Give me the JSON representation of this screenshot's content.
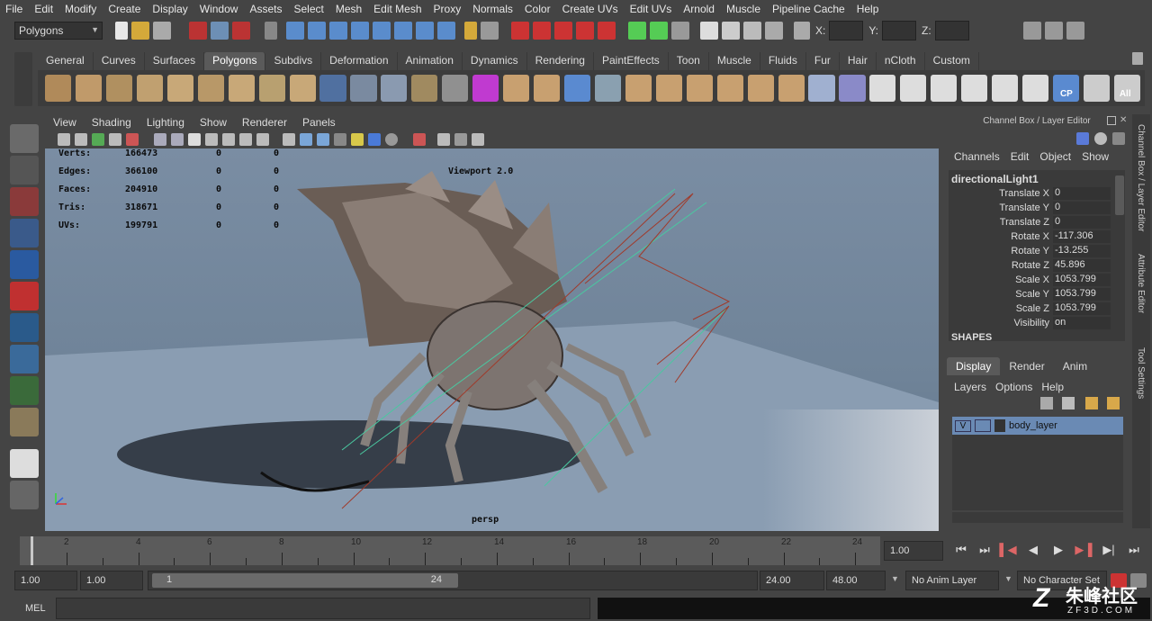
{
  "menus": [
    "File",
    "Edit",
    "Modify",
    "Create",
    "Display",
    "Window",
    "Assets",
    "Select",
    "Mesh",
    "Edit Mesh",
    "Proxy",
    "Normals",
    "Color",
    "Create UVs",
    "Edit UVs",
    "Arnold",
    "Muscle",
    "Pipeline Cache",
    "Help"
  ],
  "status": {
    "mode": "Polygons",
    "x_label": "X:",
    "y_label": "Y:",
    "z_label": "Z:"
  },
  "shelf_tabs": [
    "General",
    "Curves",
    "Surfaces",
    "Polygons",
    "Subdivs",
    "Deformation",
    "Animation",
    "Dynamics",
    "Rendering",
    "PaintEffects",
    "Toon",
    "Muscle",
    "Fluids",
    "Fur",
    "Hair",
    "nCloth",
    "Custom"
  ],
  "shelf_active": "Polygons",
  "shelf_labels": {
    "cp": "CP",
    "all": "All"
  },
  "viewport_menu": [
    "View",
    "Shading",
    "Lighting",
    "Show",
    "Renderer",
    "Panels"
  ],
  "hud": {
    "rows": [
      {
        "label": "Verts:",
        "a": "166473",
        "b": "0",
        "c": "0"
      },
      {
        "label": "Edges:",
        "a": "366100",
        "b": "0",
        "c": "0"
      },
      {
        "label": "Faces:",
        "a": "204910",
        "b": "0",
        "c": "0"
      },
      {
        "label": "Tris:",
        "a": "318671",
        "b": "0",
        "c": "0"
      },
      {
        "label": "UVs:",
        "a": "199791",
        "b": "0",
        "c": "0"
      }
    ],
    "renderer": "Viewport 2.0",
    "camera": "persp"
  },
  "channel_box": {
    "title": "Channel Box / Layer Editor",
    "menu": [
      "Channels",
      "Edit",
      "Object",
      "Show"
    ],
    "object": "directionalLight1",
    "attrs": [
      {
        "name": "Translate X",
        "value": "0"
      },
      {
        "name": "Translate Y",
        "value": "0"
      },
      {
        "name": "Translate Z",
        "value": "0"
      },
      {
        "name": "Rotate X",
        "value": "-117.306"
      },
      {
        "name": "Rotate Y",
        "value": "-13.255"
      },
      {
        "name": "Rotate Z",
        "value": "45.896"
      },
      {
        "name": "Scale X",
        "value": "1053.799"
      },
      {
        "name": "Scale Y",
        "value": "1053.799"
      },
      {
        "name": "Scale Z",
        "value": "1053.799"
      },
      {
        "name": "Visibility",
        "value": "on"
      }
    ],
    "shapes_label": "SHAPES"
  },
  "layer_editor": {
    "tabs": [
      "Display",
      "Render",
      "Anim"
    ],
    "active_tab": "Display",
    "menu": [
      "Layers",
      "Options",
      "Help"
    ],
    "layer": {
      "v": "V",
      "name": "body_layer"
    }
  },
  "side_tabs": [
    "Channel Box / Layer Editor",
    "Attribute Editor",
    "Tool Settings"
  ],
  "timeline": {
    "ticks": [
      "2",
      "4",
      "6",
      "8",
      "10",
      "12",
      "14",
      "16",
      "18",
      "20",
      "22",
      "24"
    ],
    "current_frame": "1.00"
  },
  "range": {
    "start": "1.00",
    "start2": "1.00",
    "range_start": "1",
    "range_end": "24",
    "end": "24.00",
    "end2": "48.00",
    "anim_layer": "No Anim Layer",
    "char_set": "No Character Set"
  },
  "mel": "MEL",
  "watermark": {
    "cn": "朱峰社区",
    "url": "ZF3D.COM"
  }
}
